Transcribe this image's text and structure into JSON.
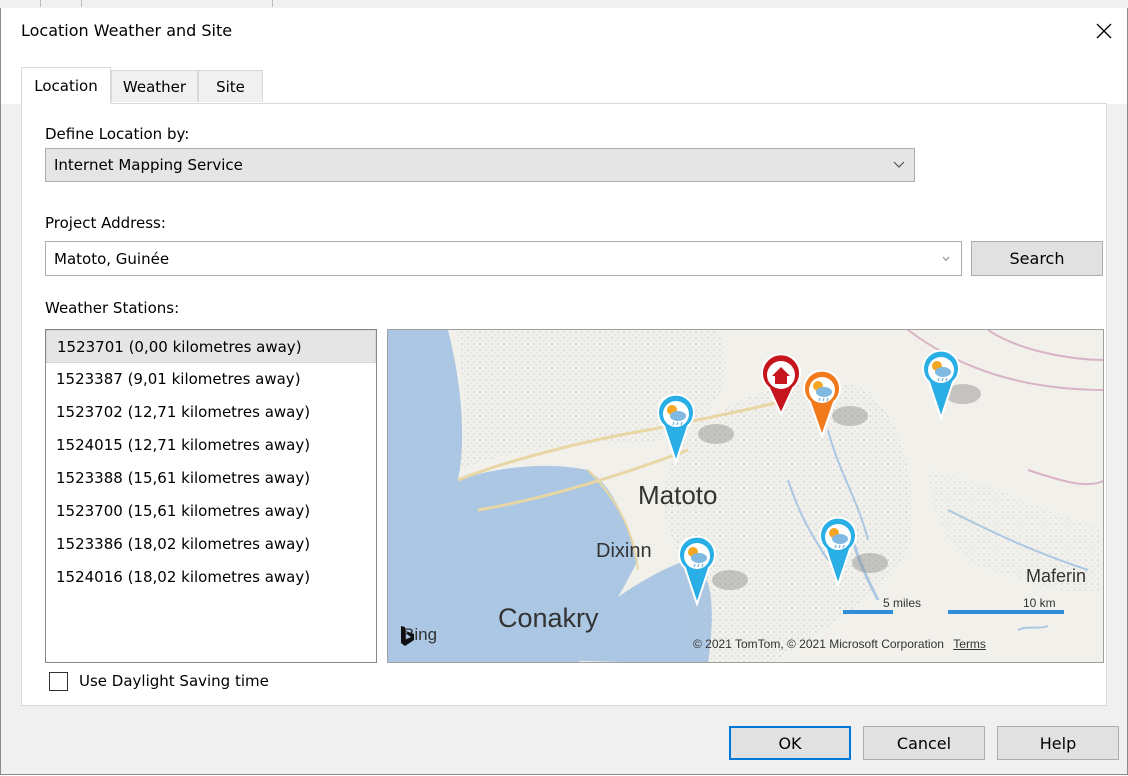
{
  "dialog": {
    "title": "Location Weather and Site"
  },
  "tabs": [
    {
      "label": "Location",
      "active": true
    },
    {
      "label": "Weather",
      "active": false
    },
    {
      "label": "Site",
      "active": false
    }
  ],
  "location": {
    "define_by_label": "Define Location by:",
    "define_by_value": "Internet Mapping Service",
    "address_label": "Project Address:",
    "address_value": "Matoto, Guinée",
    "search_label": "Search",
    "stations_label": "Weather Stations:",
    "stations": [
      "1523701 (0,00 kilometres away)",
      "1523387 (9,01 kilometres away)",
      "1523702 (12,71 kilometres away)",
      "1524015 (12,71 kilometres away)",
      "1523388 (15,61 kilometres away)",
      "1523700 (15,61 kilometres away)",
      "1523386 (18,02 kilometres away)",
      "1524016 (18,02 kilometres away)"
    ],
    "selected_station_index": 0,
    "daylight_label": "Use Daylight Saving time",
    "daylight_checked": false
  },
  "map": {
    "places": {
      "matoto": "Matoto",
      "dixinn": "Dixinn",
      "conakry": "Conakry",
      "maferinyah": "Maferin"
    },
    "bing_label": "Bing",
    "scale_miles": "5 miles",
    "scale_km": "10 km",
    "copyright": "© 2021 TomTom, © 2021 Microsoft Corporation",
    "terms": "Terms",
    "colors": {
      "project_pin": "#c4161c",
      "selected_station_pin": "#f07a1c",
      "station_pin": "#29aee6",
      "scale_bar": "#2e8fd8"
    }
  },
  "footer": {
    "ok": "OK",
    "cancel": "Cancel",
    "help": "Help"
  },
  "icons": {
    "close": "close-icon",
    "dropdown": "chevron-down-icon",
    "home": "home-icon",
    "weather": "weather-icon"
  }
}
